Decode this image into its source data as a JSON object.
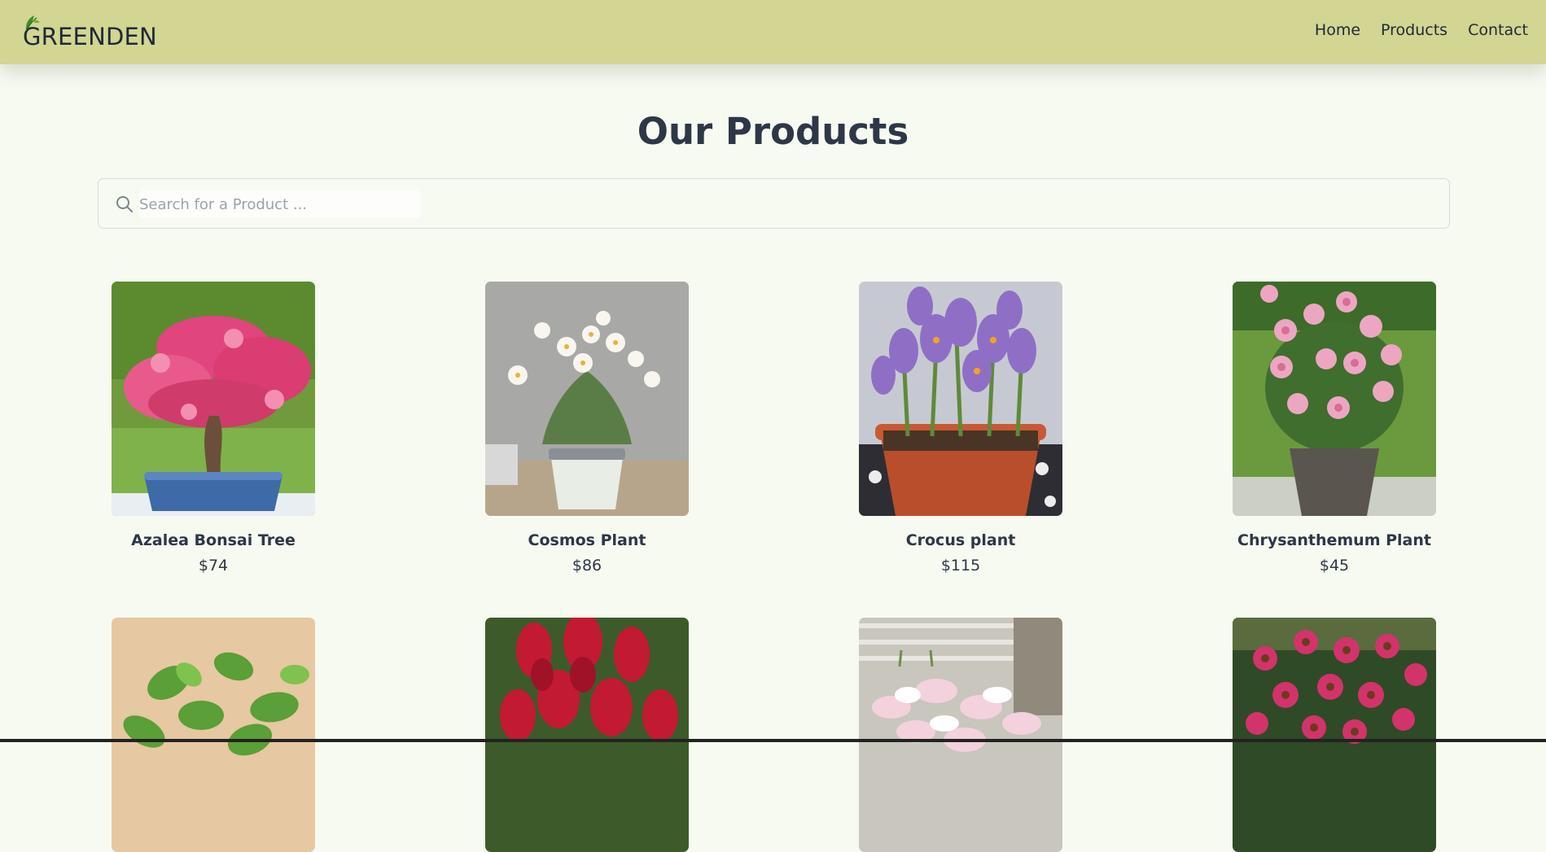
{
  "brand": {
    "logo_text": "GREENDEN",
    "logo_icon": "leaf-icon"
  },
  "nav": {
    "items": [
      "Home",
      "Products",
      "Contact"
    ]
  },
  "main": {
    "title": "Our Products",
    "search": {
      "placeholder": "Search for a Product ...",
      "value": "",
      "icon": "search-icon"
    },
    "products": [
      {
        "name": "Azalea Bonsai Tree",
        "price": "$74",
        "image": "azalea-bonsai-photo"
      },
      {
        "name": "Cosmos Plant",
        "price": "$86",
        "image": "cosmos-plant-photo"
      },
      {
        "name": "Crocus plant",
        "price": "$115",
        "image": "crocus-plant-photo"
      },
      {
        "name": "Chrysanthemum Plant",
        "price": "$45",
        "image": "chrysanthemum-plant-photo"
      },
      {
        "name": "",
        "price": "",
        "image": "jade-plant-photo"
      },
      {
        "name": "",
        "price": "",
        "image": "red-celosia-photo"
      },
      {
        "name": "",
        "price": "",
        "image": "pink-lily-photo"
      },
      {
        "name": "",
        "price": "",
        "image": "pink-echinacea-photo"
      }
    ]
  },
  "colors": {
    "header_bg": "#d3d592",
    "page_bg": "#f7faf0",
    "text": "#2d3748",
    "brand_green": "#2f7a2a"
  }
}
